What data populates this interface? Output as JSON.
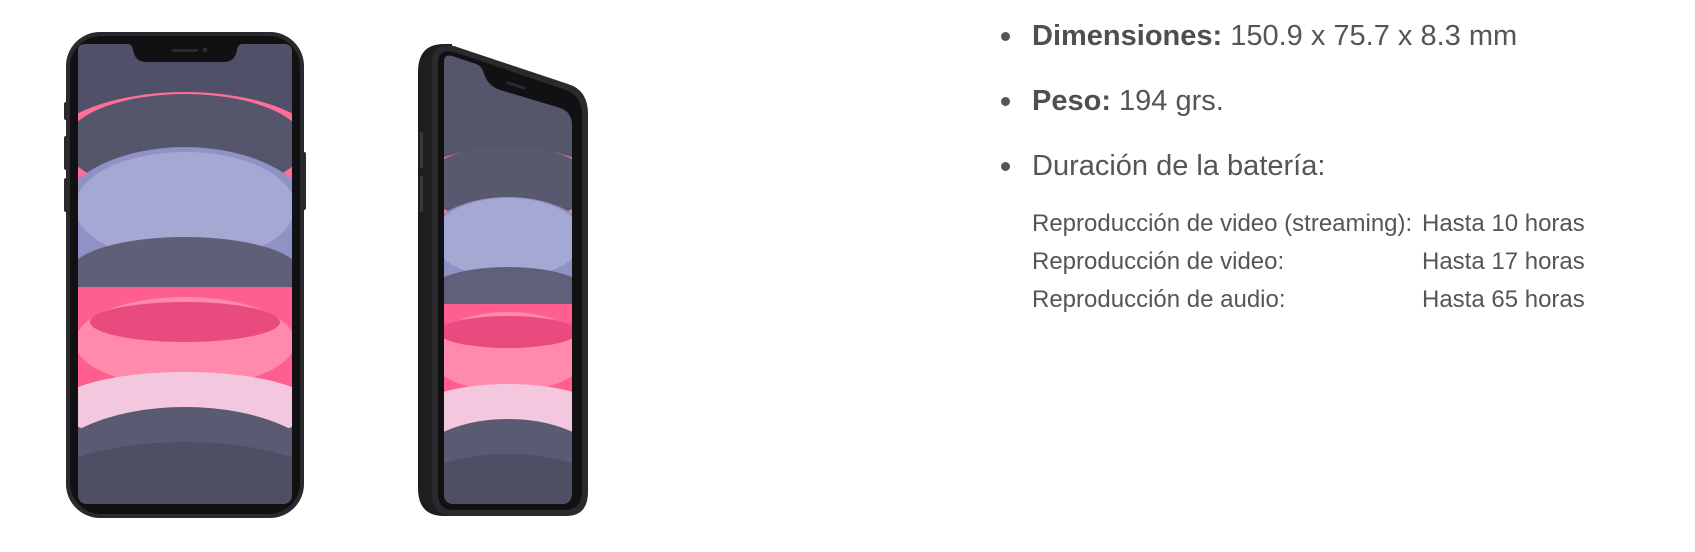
{
  "images": {
    "phone_front_alt": "iPhone 11 frente",
    "phone_side_alt": "iPhone 11 lateral"
  },
  "colors": {
    "text": "#555555",
    "label": "#4f4f4f",
    "phone_body": "#2a2a2c",
    "wallpaper_dark": "#55556a",
    "wallpaper_lavender": "#8f90c4",
    "wallpaper_pink": "#ff5a8c"
  },
  "specs": {
    "items": [
      {
        "label": "Dimensiones:",
        "value": "150.9 x 75.7 x 8.3 mm"
      },
      {
        "label": "Peso:",
        "value": "194 grs."
      },
      {
        "label": "",
        "value": "Duración de la batería:"
      }
    ],
    "battery": [
      {
        "activity": "Reproducción de video (streaming):",
        "duration": "Hasta 10 horas"
      },
      {
        "activity": "Reproducción de video:",
        "duration": "Hasta 17 horas"
      },
      {
        "activity": "Reproducción de audio:",
        "duration": "Hasta 65 horas"
      }
    ]
  }
}
